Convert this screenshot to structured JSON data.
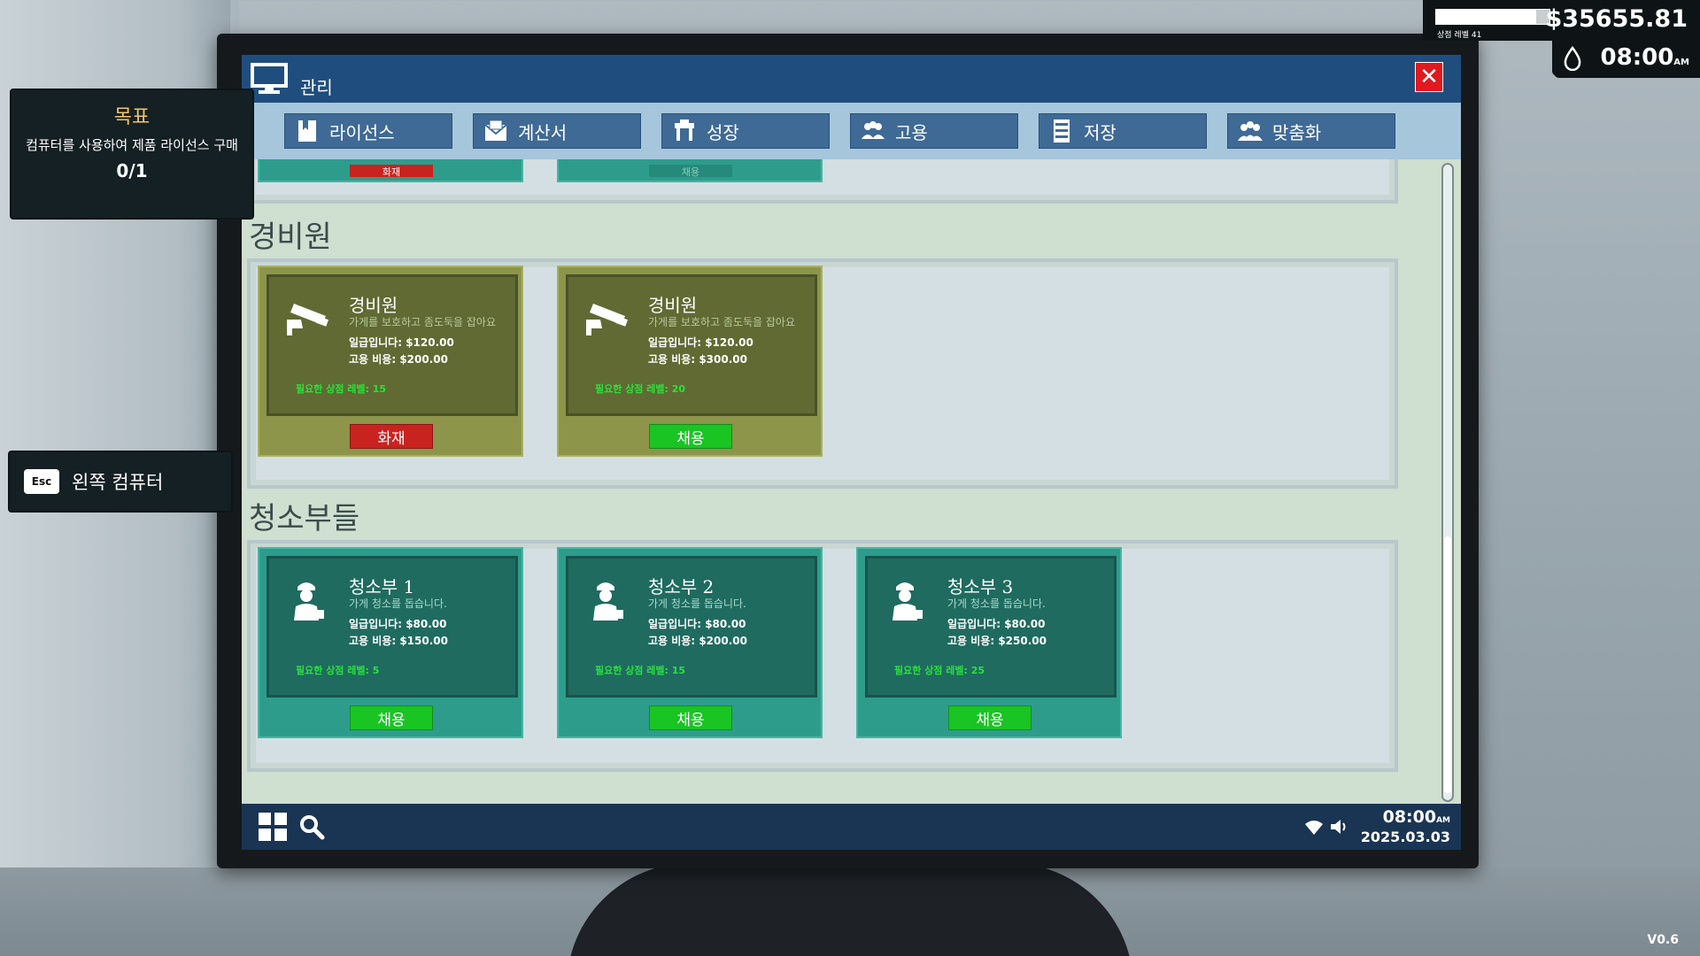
{
  "window": {
    "title": "관리",
    "close_label": "✕"
  },
  "tabs": [
    {
      "label": "라이선스",
      "icon": "license-icon"
    },
    {
      "label": "계산서",
      "icon": "invoice-icon"
    },
    {
      "label": "성장",
      "icon": "growth-icon"
    },
    {
      "label": "고용",
      "icon": "hire-icon"
    },
    {
      "label": "저장",
      "icon": "save-icon"
    },
    {
      "label": "맞춤화",
      "icon": "customize-icon"
    }
  ],
  "sections": {
    "guards": {
      "title": "경비원",
      "cards": [
        {
          "name": "경비원",
          "desc": "가게를 보호하고 좀도둑을 잡아요",
          "wage_label": "일급입니다: ",
          "wage": "$120.00",
          "cost_label": "고용 비용: ",
          "cost": "$200.00",
          "level_label": "필요한 상점 레벨: ",
          "level": "15",
          "button": "화재",
          "button_type": "fire",
          "icon": "security-camera-icon"
        },
        {
          "name": "경비원",
          "desc": "가게를 보호하고 좀도둑을 잡아요",
          "wage_label": "일급입니다: ",
          "wage": "$120.00",
          "cost_label": "고용 비용: ",
          "cost": "$300.00",
          "level_label": "필요한 상점 레벨: ",
          "level": "20",
          "button": "채용",
          "button_type": "hire",
          "icon": "security-camera-icon"
        }
      ]
    },
    "cleaners": {
      "title": "청소부들",
      "cards": [
        {
          "name": "청소부 1",
          "desc": "가게 청소를 돕습니다.",
          "wage_label": "일급입니다: ",
          "wage": "$80.00",
          "cost_label": "고용 비용: ",
          "cost": "$150.00",
          "level_label": "필요한 상점 레벨: ",
          "level": "5",
          "button": "채용",
          "button_type": "hire",
          "icon": "cleaner-icon"
        },
        {
          "name": "청소부 2",
          "desc": "가게 청소를 돕습니다.",
          "wage_label": "일급입니다: ",
          "wage": "$80.00",
          "cost_label": "고용 비용: ",
          "cost": "$200.00",
          "level_label": "필요한 상점 레벨: ",
          "level": "15",
          "button": "채용",
          "button_type": "hire",
          "icon": "cleaner-icon"
        },
        {
          "name": "청소부 3",
          "desc": "가게 청소를 돕습니다.",
          "wage_label": "일급입니다: ",
          "wage": "$80.00",
          "cost_label": "고용 비용: ",
          "cost": "$250.00",
          "level_label": "필요한 상점 레벨: ",
          "level": "25",
          "button": "채용",
          "button_type": "hire",
          "icon": "cleaner-icon"
        }
      ]
    },
    "prev_buttons": [
      "화재",
      "채용"
    ]
  },
  "taskbar": {
    "time": "08:00",
    "ampm": "AM",
    "date": "2025.03.03"
  },
  "objective": {
    "heading": "목표",
    "text": "컴퓨터를 사용하여 제품 라이선스 구매",
    "progress": "0/1"
  },
  "esc_hint": {
    "key": "Esc",
    "label": "왼쪽 컴퓨터"
  },
  "hud": {
    "money": "$35655.81",
    "level_label": "상점 레벨 41",
    "level_progress": 0.88,
    "time": "08:00",
    "ampm": "AM"
  },
  "version": "V0.6",
  "colors": {
    "titlebar": "#1f4e7e",
    "hire": "#19c423",
    "fire": "#c92320",
    "level_text": "#29e23a"
  }
}
